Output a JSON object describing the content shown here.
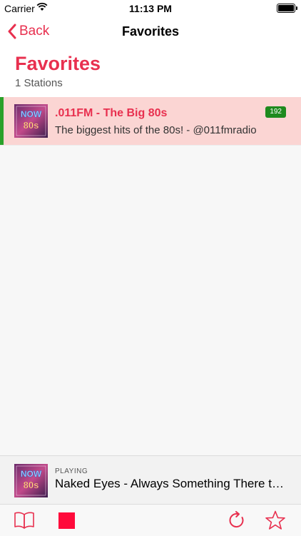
{
  "status_bar": {
    "carrier": "Carrier",
    "time": "11:13 PM"
  },
  "nav": {
    "back_label": "Back",
    "title": "Favorites"
  },
  "header": {
    "large_title": "Favorites",
    "count_label": "1 Stations"
  },
  "stations": [
    {
      "name": ".011FM - The Big 80s",
      "description": "The biggest hits of the 80s! - @011fmradio",
      "bitrate": "192",
      "artwork_text": [
        "NOW",
        "80s"
      ]
    }
  ],
  "now_playing": {
    "label": "PLAYING",
    "track": "Naked Eyes - Always Something There to Remind Me",
    "artwork_text": [
      "NOW",
      "80s"
    ]
  },
  "toolbar": {
    "items": [
      "book-icon",
      "stop-icon",
      "refresh-icon",
      "star-icon"
    ]
  },
  "colors": {
    "accent": "#e8304f",
    "selected_row": "#fbd5d3",
    "playing_indicator": "#2aa12a",
    "bitrate_badge": "#1e8a1e",
    "stop": "#ff0a3b"
  }
}
